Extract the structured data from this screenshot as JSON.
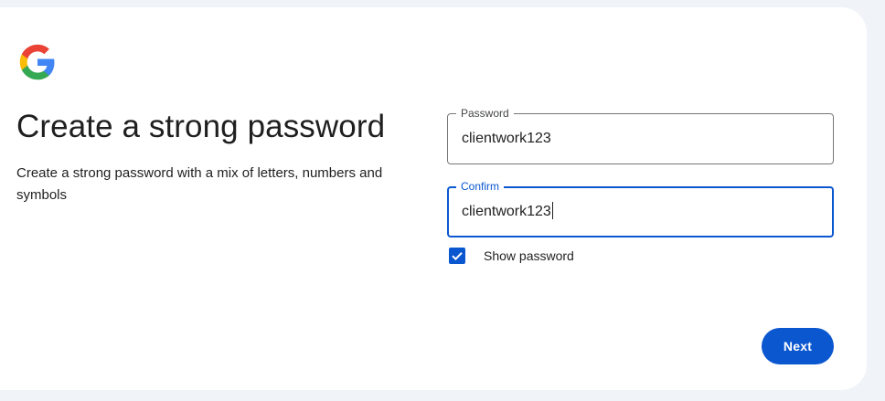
{
  "page": {
    "heading": "Create a strong password",
    "subtext": "Create a strong password with a mix of letters, numbers and symbols"
  },
  "logo": {
    "icon": "google-g-logo-icon",
    "colors": {
      "blue": "#4285F4",
      "green": "#34A853",
      "yellow": "#FBBC05",
      "red": "#EA4335"
    }
  },
  "form": {
    "password": {
      "label": "Password",
      "value": "clientwork123"
    },
    "confirm": {
      "label": "Confirm",
      "value": "clientwork123",
      "focused": true
    },
    "show_password": {
      "label": "Show password",
      "checked": true
    }
  },
  "actions": {
    "next_label": "Next"
  },
  "colors": {
    "accent": "#0b57d0",
    "background": "#f0f4f9",
    "card": "#ffffff",
    "text": "#1f1f1f"
  }
}
